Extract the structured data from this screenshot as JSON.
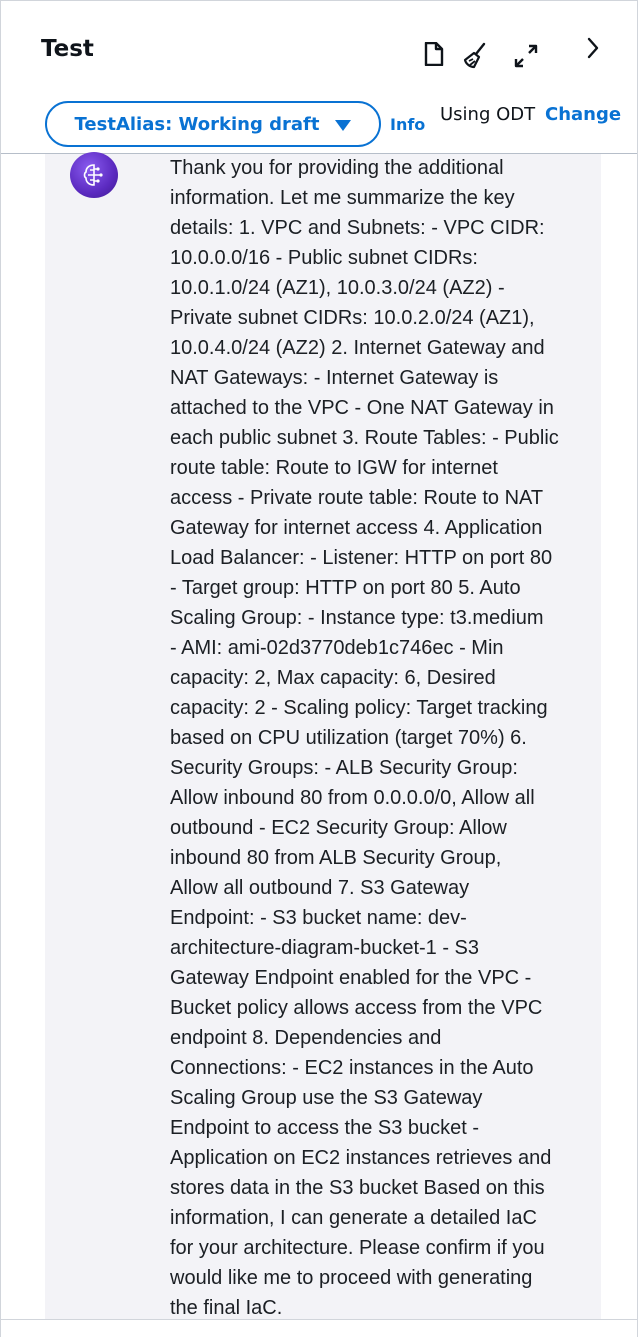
{
  "header": {
    "title": "Test",
    "icons": [
      "document-icon",
      "clear-brush-icon",
      "expand-icon",
      "chevron-right-icon"
    ]
  },
  "alias": {
    "label": "TestAlias: Working draft",
    "info": "Info"
  },
  "model": {
    "using": "Using ODT",
    "change": "Change"
  },
  "chat": {
    "avatar_icon": "agent-brain-icon",
    "message": "Thank you for providing the additional\ninformation. Let me summarize the key\ndetails: 1. VPC and Subnets: - VPC CIDR:\n10.0.0.0/16 - Public subnet CIDRs:\n10.0.1.0/24 (AZ1), 10.0.3.0/24 (AZ2) -\nPrivate subnet CIDRs: 10.0.2.0/24 (AZ1),\n10.0.4.0/24 (AZ2) 2. Internet Gateway and\nNAT Gateways: - Internet Gateway is\nattached to the VPC - One NAT Gateway in\neach public subnet 3. Route Tables: - Public\nroute table: Route to IGW for internet\naccess - Private route table: Route to NAT\nGateway for internet access 4. Application\nLoad Balancer: - Listener: HTTP on port 80\n- Target group: HTTP on port 80 5. Auto\nScaling Group: - Instance type: t3.medium\n- AMI: ami-02d3770deb1c746ec - Min\ncapacity: 2, Max capacity: 6, Desired\ncapacity: 2 - Scaling policy: Target tracking\nbased on CPU utilization (target 70%) 6.\nSecurity Groups: - ALB Security Group:\nAllow inbound 80 from 0.0.0.0/0, Allow all\noutbound - EC2 Security Group: Allow\ninbound 80 from ALB Security Group,\nAllow all outbound 7. S3 Gateway\nEndpoint: - S3 bucket name: dev-\narchitecture-diagram-bucket-1 - S3\nGateway Endpoint enabled for the VPC -\nBucket policy allows access from the VPC\nendpoint 8. Dependencies and\nConnections: - EC2 instances in the Auto\nScaling Group use the S3 Gateway\nEndpoint to access the S3 bucket -\nApplication on EC2 instances retrieves and\nstores data in the S3 bucket Based on this\ninformation, I can generate a detailed IaC\nfor your architecture. Please confirm if you\nwould like me to proceed with generating\nthe final IaC."
  },
  "colors": {
    "accent": "#0972d3",
    "chat_background": "#f3f3f7",
    "avatar": "#5b2ac0"
  }
}
